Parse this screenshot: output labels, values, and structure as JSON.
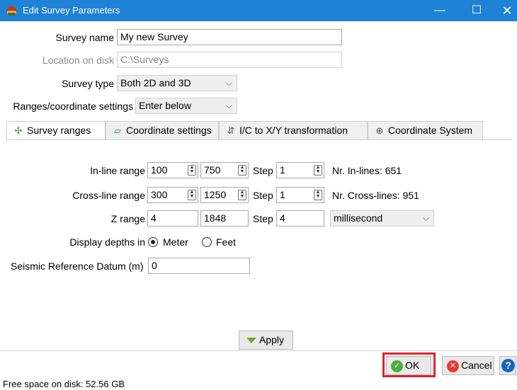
{
  "window": {
    "title": "Edit Survey Parameters",
    "minimize_glyph": "—",
    "maximize_glyph": "☐",
    "close_glyph": "✕",
    "accent_color": "#1e82d6"
  },
  "form": {
    "survey_name_label": "Survey name",
    "survey_name_value": "My new Survey",
    "location_label": "Location on disk",
    "location_value": "C:\\Surveys",
    "survey_type_label": "Survey type",
    "survey_type_value": "Both 2D and 3D",
    "ranges_label": "Ranges/coordinate settings",
    "ranges_value": "Enter below"
  },
  "tabs": [
    {
      "label": "Survey ranges",
      "icon": "crosshair-icon",
      "active": true
    },
    {
      "label": "Coordinate settings",
      "icon": "map-grid-icon",
      "active": false
    },
    {
      "label": "I/C to X/Y transformation",
      "icon": "transform-icon",
      "active": false
    },
    {
      "label": "Coordinate System",
      "icon": "globe-pin-icon",
      "active": false
    }
  ],
  "ranges": {
    "inline": {
      "label": "In-line range",
      "start": "100",
      "stop": "750",
      "step_label": "Step",
      "step": "1",
      "count_text": "Nr. In-lines: 651"
    },
    "crossline": {
      "label": "Cross-line range",
      "start": "300",
      "stop": "1250",
      "step_label": "Step",
      "step": "1",
      "count_text": "Nr. Cross-lines: 951"
    },
    "z": {
      "label": "Z range",
      "start": "4",
      "stop": "1848",
      "step_label": "Step",
      "step": "4",
      "unit": "millisecond"
    },
    "depth_label": "Display depths in",
    "depth_meter": "Meter",
    "depth_feet": "Feet",
    "datum_label": "Seismic Reference Datum (m)",
    "datum_value": "0"
  },
  "buttons": {
    "apply": "Apply",
    "ok": "OK",
    "cancel": "Cancel",
    "help": "?"
  },
  "status": {
    "text": "Free space on disk: 52.56 GB"
  },
  "highlight_color": "#e4202a"
}
